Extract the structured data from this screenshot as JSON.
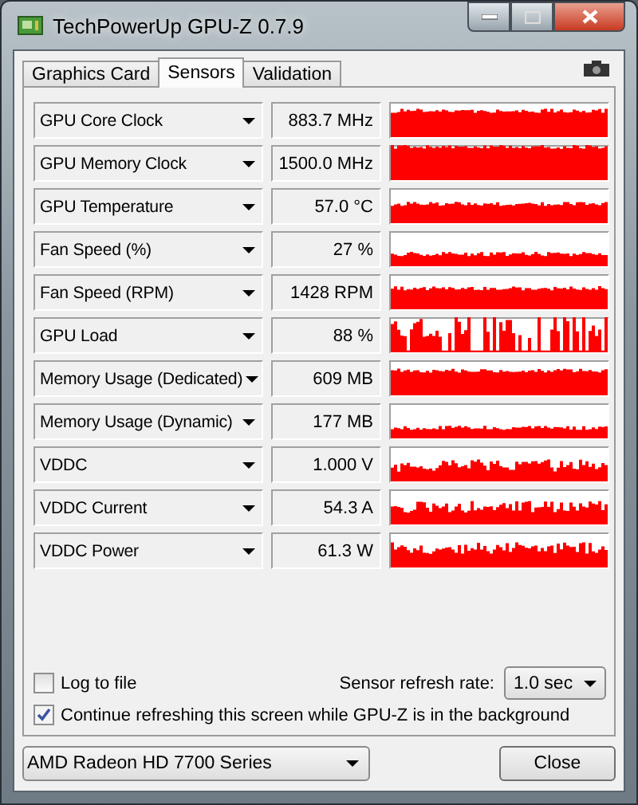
{
  "window": {
    "title": "TechPowerUp GPU-Z 0.7.9"
  },
  "tabs": [
    {
      "label": "Graphics Card",
      "selected": false
    },
    {
      "label": "Sensors",
      "selected": true
    },
    {
      "label": "Validation",
      "selected": false
    }
  ],
  "sensors": [
    {
      "name": "GPU Core Clock",
      "reading": "883.7 MHz"
    },
    {
      "name": "GPU Memory Clock",
      "reading": "1500.0 MHz"
    },
    {
      "name": "GPU Temperature",
      "reading": "57.0 °C"
    },
    {
      "name": "Fan Speed (%)",
      "reading": "27 %"
    },
    {
      "name": "Fan Speed (RPM)",
      "reading": "1428 RPM"
    },
    {
      "name": "GPU Load",
      "reading": "88 %"
    },
    {
      "name": "Memory Usage (Dedicated)",
      "reading": "609 MB"
    },
    {
      "name": "Memory Usage (Dynamic)",
      "reading": "177 MB"
    },
    {
      "name": "VDDC",
      "reading": "1.000 V"
    },
    {
      "name": "VDDC Current",
      "reading": "54.3 A"
    },
    {
      "name": "VDDC Power",
      "reading": "61.3 W"
    }
  ],
  "options": [
    {
      "label": "Log to file",
      "checked": false
    },
    {
      "label": "Continue refreshing this screen while GPU-Z is in the background",
      "checked": true
    }
  ],
  "refresh_rate": {
    "label": "Sensor refresh rate:",
    "value": "1.0 sec"
  },
  "gpu_select": {
    "value": "AMD Radeon HD 7700 Series"
  },
  "buttons": [
    "Close"
  ]
}
